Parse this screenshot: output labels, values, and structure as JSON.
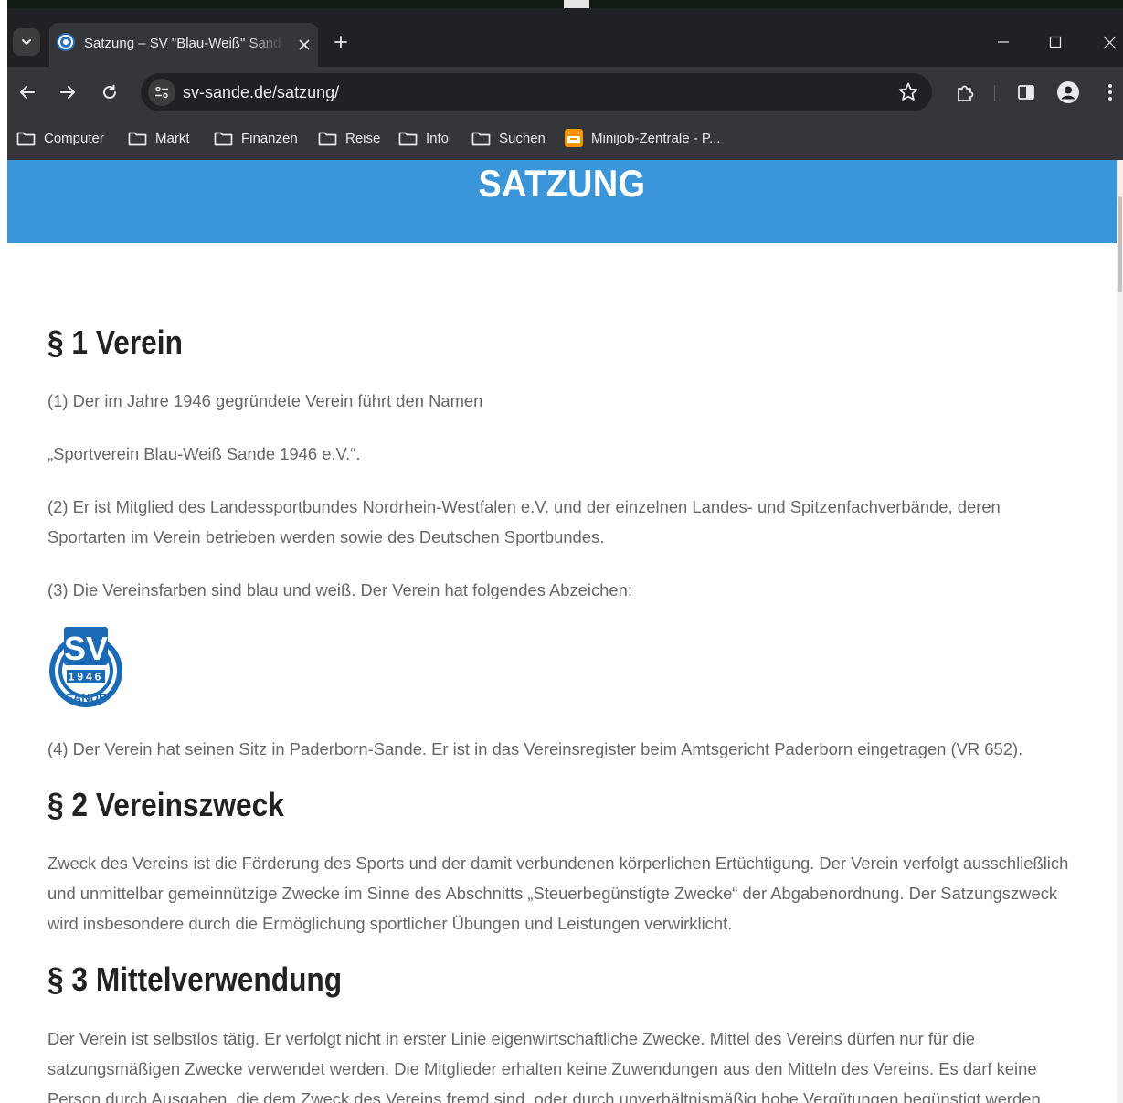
{
  "browser": {
    "tab": {
      "title": "Satzung – SV \"Blau-Weiß\" Sande",
      "close_icon": "close-icon"
    },
    "address_bar": {
      "url": "sv-sande.de/satzung/"
    },
    "bookmarks": [
      {
        "label": "Computer",
        "icon": "folder-icon"
      },
      {
        "label": "Markt",
        "icon": "folder-icon"
      },
      {
        "label": "Finanzen",
        "icon": "folder-icon"
      },
      {
        "label": "Reise",
        "icon": "folder-icon"
      },
      {
        "label": "Info",
        "icon": "folder-icon"
      },
      {
        "label": "Suchen",
        "icon": "folder-icon"
      },
      {
        "label": "Minijob-Zentrale - P...",
        "icon": "minijob-favicon"
      }
    ]
  },
  "page": {
    "title": "SATZUNG",
    "accent_color": "#3a96d8",
    "logo": {
      "text_top": "SV",
      "text_year": "1946",
      "text_bottom": "SANDE"
    },
    "sections": [
      {
        "heading": "§ 1 Verein",
        "paragraphs": [
          "(1) Der im Jahre 1946 gegründete Verein führt den Namen",
          "„Sportverein Blau-Weiß Sande 1946 e.V.“.",
          "(2) Er ist Mitglied des Landessportbundes Nordrhein-Westfalen e.V. und der einzelnen Landes- und Spitzenfachverbände, deren Sportarten im Verein betrieben werden sowie des Deutschen Sportbundes.",
          "(3) Die Vereinsfarben sind blau und weiß. Der Verein hat folgendes Abzeichen:",
          "(4) Der Verein hat seinen Sitz in Paderborn-Sande. Er ist in das Vereinsregister beim Amtsgericht Paderborn eingetragen (VR 652)."
        ]
      },
      {
        "heading": "§ 2 Vereinszweck",
        "paragraphs": [
          "Zweck des Vereins ist die Förderung des Sports und der damit verbundenen körperlichen Ertüchtigung. Der Verein verfolgt ausschließlich und unmittelbar gemeinnützige Zwecke im Sinne des Abschnitts „Steuerbegünstigte Zwecke“ der Abgabenordnung. Der Satzungszweck wird insbesondere durch die Ermöglichung sportlicher Übungen und Leistungen verwirklicht."
        ]
      },
      {
        "heading": "§ 3 Mittelverwendung",
        "paragraphs": [
          "Der Verein ist selbstlos tätig. Er verfolgt nicht in erster Linie eigenwirtschaftliche Zwecke. Mittel des Vereins dürfen nur für die satzungsmäßigen Zwecke verwendet werden. Die Mitglieder erhalten keine Zuwendungen aus den Mitteln des Vereins. Es darf keine Person durch Ausgaben, die dem Zweck des Vereins fremd sind, oder durch unverhältnismäßig hohe Vergütungen begünstigt werden."
        ]
      }
    ]
  }
}
